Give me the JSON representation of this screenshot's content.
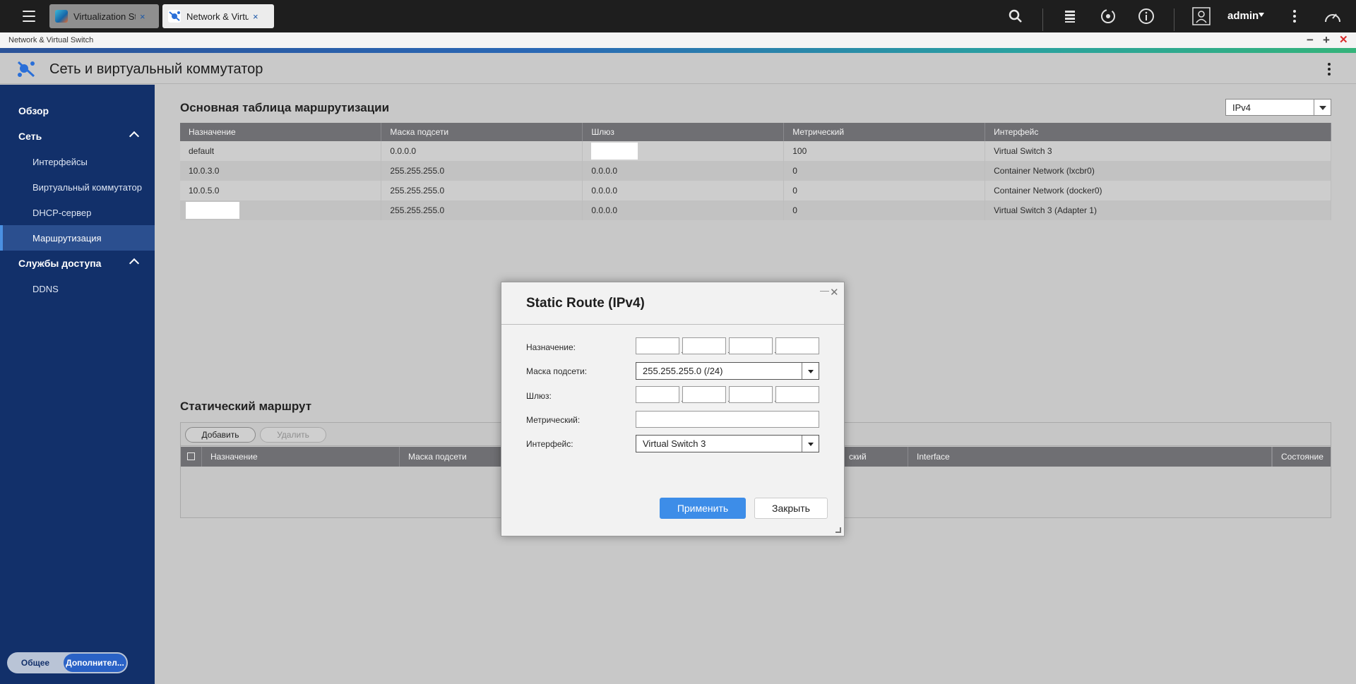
{
  "taskbar": {
    "tabs": [
      {
        "label": "Virtualization St...",
        "close": "×"
      },
      {
        "label": "Network & Virtu...",
        "close": "×"
      }
    ],
    "user": "admin"
  },
  "window": {
    "title": "Network & Virtual Switch",
    "controls": {
      "minimize": "−",
      "maximize": "+",
      "close": "✕"
    }
  },
  "app": {
    "title": "Сеть и виртуальный коммутатор"
  },
  "sidebar": {
    "items": [
      {
        "label": "Обзор"
      },
      {
        "label": "Сеть"
      },
      {
        "label": "Интерфейсы"
      },
      {
        "label": "Виртуальный коммутатор"
      },
      {
        "label": "DHCP-сервер"
      },
      {
        "label": "Маршрутизация"
      },
      {
        "label": "Службы доступа"
      },
      {
        "label": "DDNS"
      }
    ],
    "mode": {
      "basic": "Общее",
      "advanced": "Дополнител..."
    }
  },
  "main": {
    "routing_title": "Основная таблица маршрутизации",
    "ip_version": "IPv4",
    "routing_table": {
      "columns": [
        "Назначение",
        "Маска подсети",
        "Шлюз",
        "Метрический",
        "Интерфейс"
      ],
      "rows": [
        [
          "default",
          "0.0.0.0",
          "",
          "100",
          "Virtual Switch 3"
        ],
        [
          "10.0.3.0",
          "255.255.255.0",
          "0.0.0.0",
          "0",
          "Container Network (lxcbr0)"
        ],
        [
          "10.0.5.0",
          "255.255.255.0",
          "0.0.0.0",
          "0",
          "Container Network (docker0)"
        ],
        [
          "",
          "255.255.255.0",
          "0.0.0.0",
          "0",
          "Virtual Switch 3 (Adapter 1)"
        ]
      ]
    },
    "static_title": "Статический маршрут",
    "static_buttons": {
      "add": "Добавить",
      "delete": "Удалить"
    },
    "static_columns": [
      "Назначение",
      "Маска подсети",
      "ский",
      "Interface",
      "Состояние"
    ]
  },
  "dialog": {
    "title": "Static Route (IPv4)",
    "fields": {
      "destination_label": "Назначение:",
      "mask_label": "Маска подсети:",
      "mask_value": "255.255.255.0 (/24)",
      "gateway_label": "Шлюз:",
      "metric_label": "Метрический:",
      "interface_label": "Интерфейс:",
      "interface_value": "Virtual Switch 3"
    },
    "buttons": {
      "apply": "Применить",
      "close": "Закрыть"
    }
  }
}
